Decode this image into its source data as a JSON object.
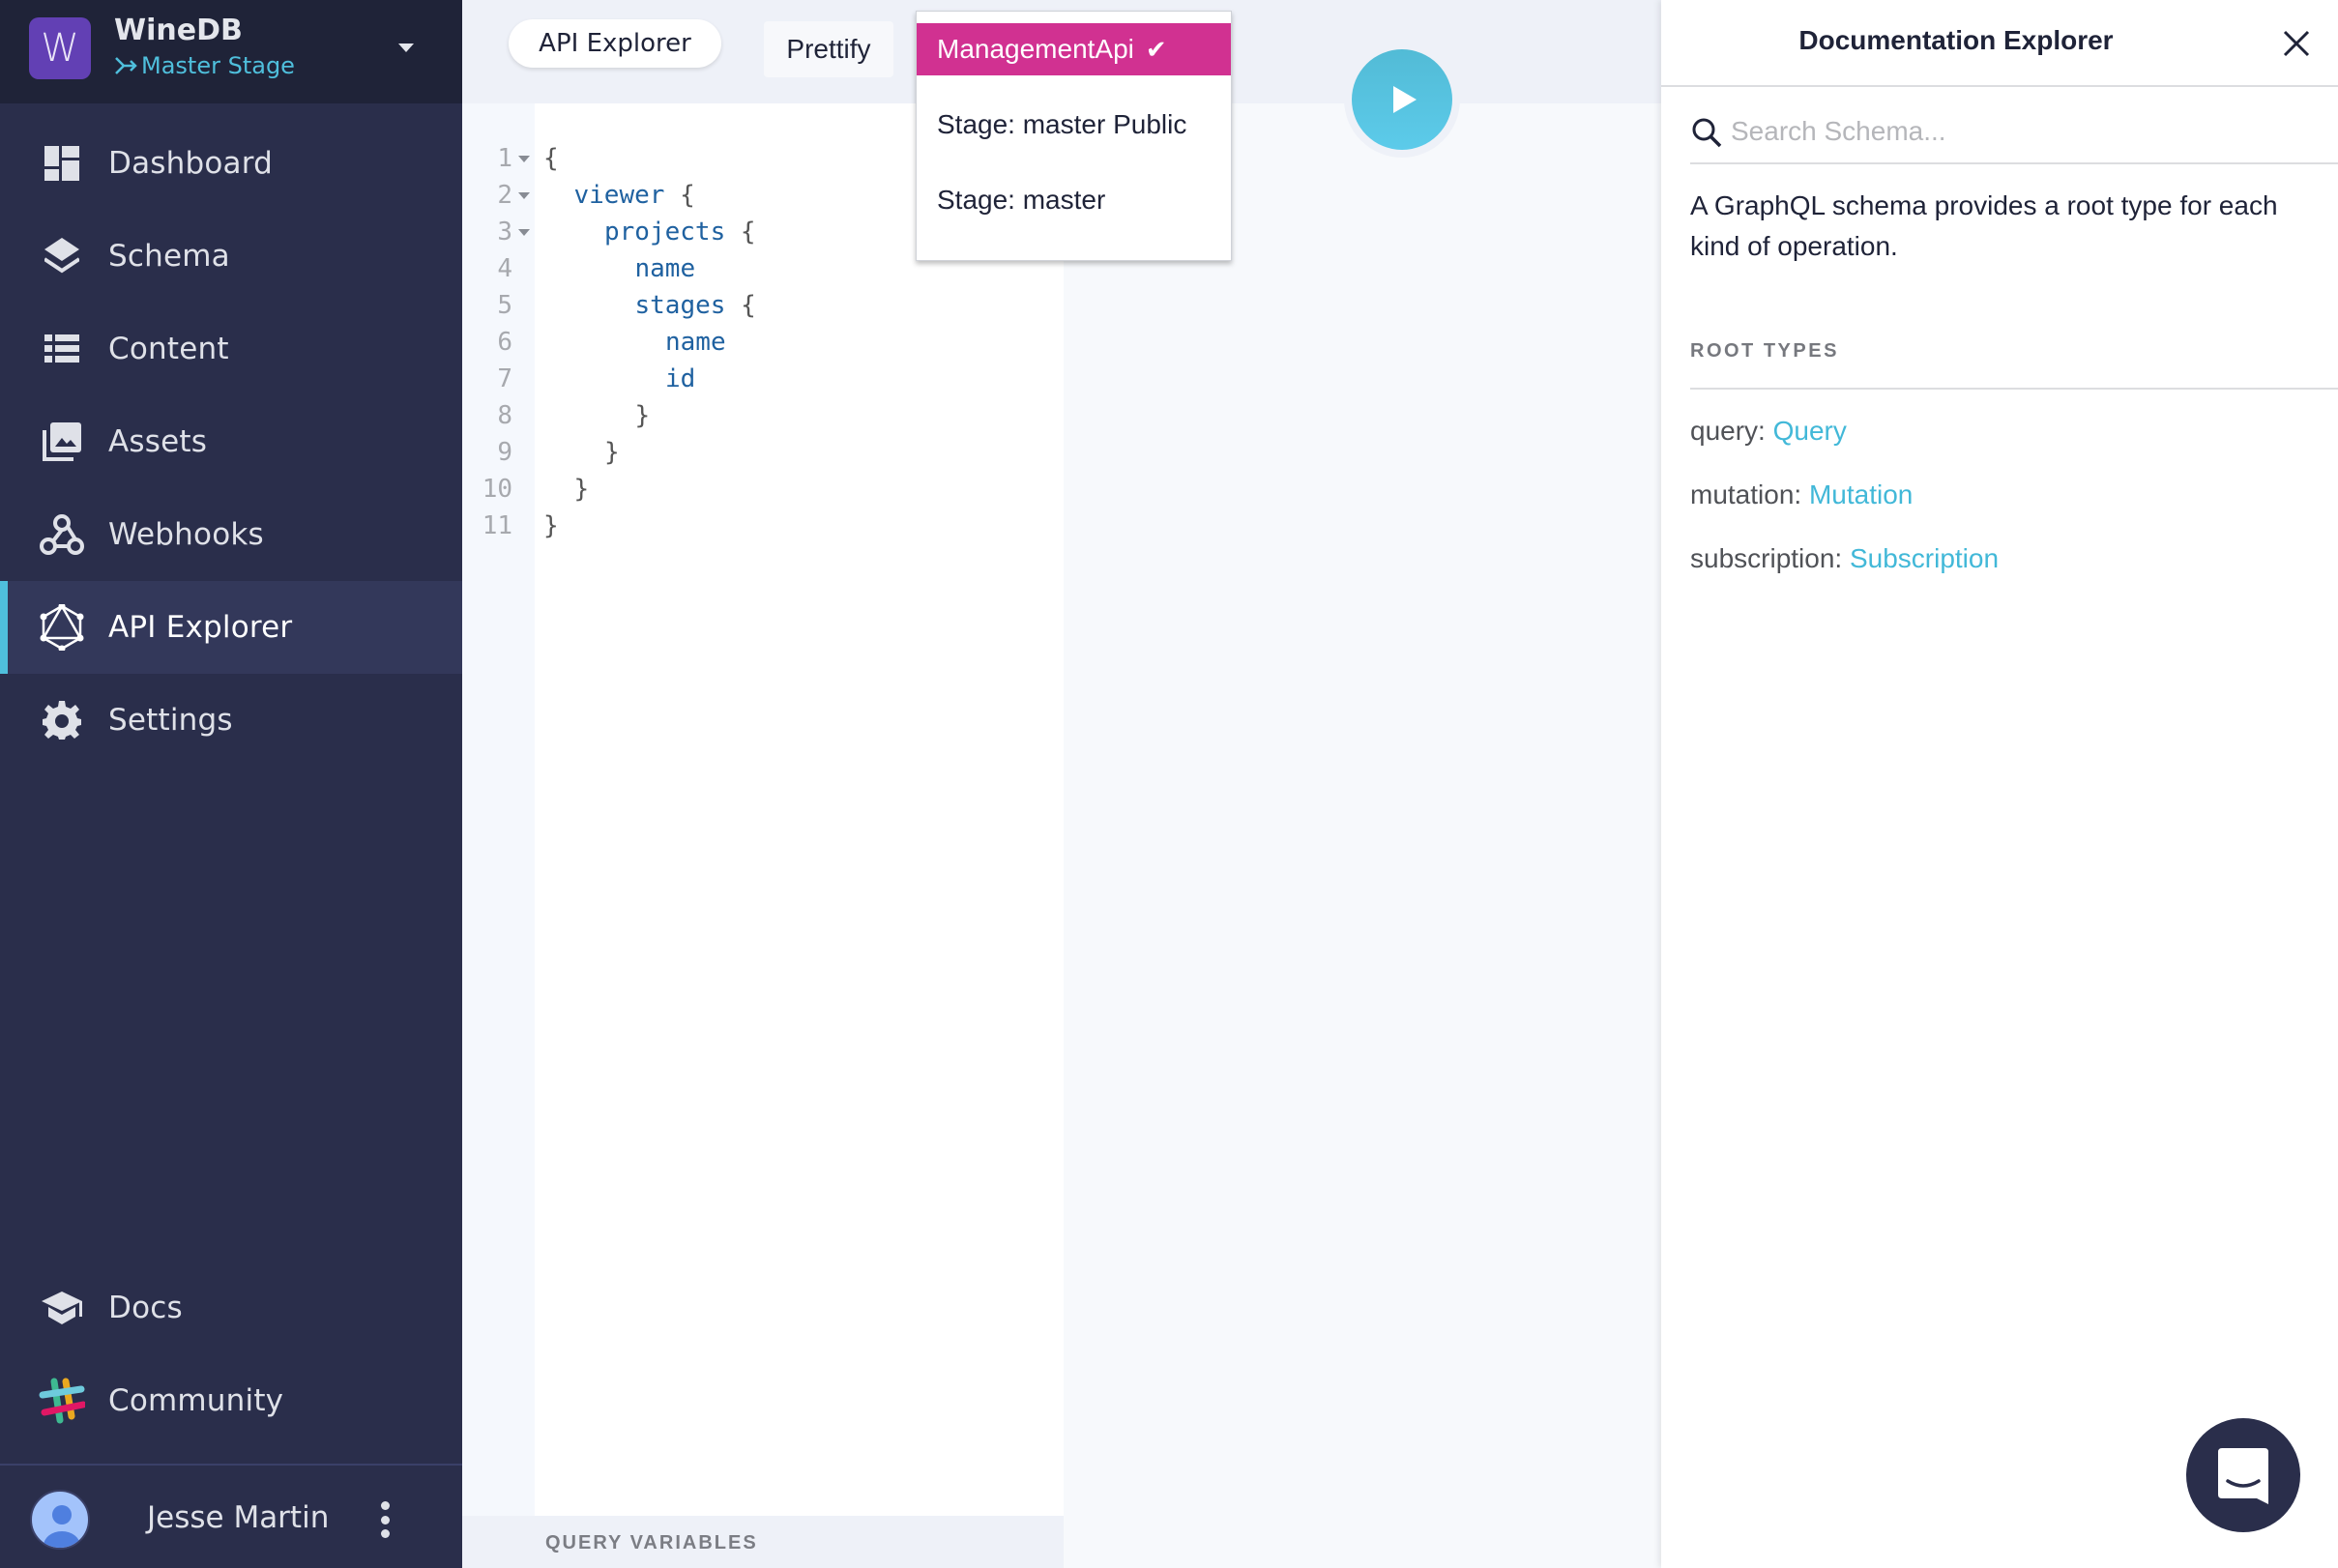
{
  "project": {
    "initial": "W",
    "name": "WineDB",
    "stage": "Master Stage",
    "stage_icon": "merge-arrow-icon",
    "menu_icon": "caret-down-icon"
  },
  "sidebar": {
    "items": [
      {
        "label": "Dashboard",
        "icon": "dashboard-icon",
        "active": false
      },
      {
        "label": "Schema",
        "icon": "layers-icon",
        "active": false
      },
      {
        "label": "Content",
        "icon": "list-icon",
        "active": false
      },
      {
        "label": "Assets",
        "icon": "images-icon",
        "active": false
      },
      {
        "label": "Webhooks",
        "icon": "webhook-icon",
        "active": false
      },
      {
        "label": "API Explorer",
        "icon": "graphql-icon",
        "active": true
      },
      {
        "label": "Settings",
        "icon": "gear-icon",
        "active": false
      }
    ],
    "bottom_items": [
      {
        "label": "Docs",
        "icon": "graduation-cap-icon"
      },
      {
        "label": "Community",
        "icon": "slack-icon"
      }
    ],
    "user": {
      "name": "Jesse Martin",
      "menu_icon": "more-vertical-icon"
    },
    "accent": "#4fbfdc",
    "background": "#2a2e4b"
  },
  "toolbar": {
    "tab_label": "API Explorer",
    "prettify_label": "Prettify",
    "run_icon": "play-icon"
  },
  "endpoint_dropdown": {
    "options": [
      {
        "label": "ManagementApi",
        "selected": true
      },
      {
        "label": "Stage: master Public",
        "selected": false
      },
      {
        "label": "Stage: master",
        "selected": false
      }
    ],
    "selected_color": "#d13191",
    "check_icon": "✔"
  },
  "editor": {
    "lines": [
      {
        "n": "1",
        "fold": true,
        "indent": 0,
        "tokens": [
          {
            "t": "{",
            "c": "br"
          }
        ]
      },
      {
        "n": "2",
        "fold": true,
        "indent": 1,
        "tokens": [
          {
            "t": "viewer",
            "c": "kw"
          },
          {
            "t": " {",
            "c": "br"
          }
        ]
      },
      {
        "n": "3",
        "fold": true,
        "indent": 2,
        "tokens": [
          {
            "t": "projects",
            "c": "kw"
          },
          {
            "t": " {",
            "c": "br"
          }
        ]
      },
      {
        "n": "4",
        "fold": false,
        "indent": 3,
        "tokens": [
          {
            "t": "name",
            "c": "kw"
          }
        ]
      },
      {
        "n": "5",
        "fold": false,
        "indent": 3,
        "tokens": [
          {
            "t": "stages",
            "c": "kw"
          },
          {
            "t": " {",
            "c": "br"
          }
        ]
      },
      {
        "n": "6",
        "fold": false,
        "indent": 4,
        "tokens": [
          {
            "t": "name",
            "c": "kw"
          }
        ]
      },
      {
        "n": "7",
        "fold": false,
        "indent": 4,
        "tokens": [
          {
            "t": "id",
            "c": "kw"
          }
        ]
      },
      {
        "n": "8",
        "fold": false,
        "indent": 3,
        "tokens": [
          {
            "t": "}",
            "c": "br"
          }
        ]
      },
      {
        "n": "9",
        "fold": false,
        "indent": 2,
        "tokens": [
          {
            "t": "}",
            "c": "br"
          }
        ]
      },
      {
        "n": "10",
        "fold": false,
        "indent": 1,
        "tokens": [
          {
            "t": "}",
            "c": "br"
          }
        ]
      },
      {
        "n": "11",
        "fold": false,
        "indent": 0,
        "tokens": [
          {
            "t": "}",
            "c": "br"
          }
        ]
      }
    ],
    "query_variables_label": "QUERY VARIABLES"
  },
  "docs": {
    "title": "Documentation Explorer",
    "close_icon": "close-icon",
    "search_placeholder": "Search Schema...",
    "search_value": "",
    "description": "A GraphQL schema provides a root type for each kind of operation.",
    "section_title": "ROOT TYPES",
    "root_types": [
      {
        "field": "query: ",
        "type": "Query"
      },
      {
        "field": "mutation: ",
        "type": "Mutation"
      },
      {
        "field": "subscription: ",
        "type": "Subscription"
      }
    ],
    "link_color": "#42b8d8"
  },
  "chat": {
    "icon": "chat-icon"
  }
}
